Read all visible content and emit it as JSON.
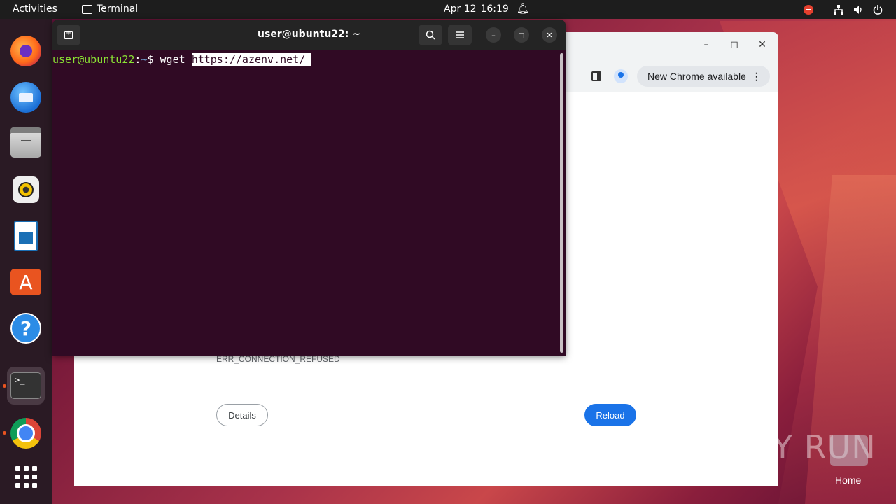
{
  "topbar": {
    "activities": "Activities",
    "app_name": "Terminal",
    "date": "Apr 12",
    "time": "16:19"
  },
  "dock": {
    "items": [
      "firefox-icon",
      "thunderbird-icon",
      "files-icon",
      "rhythmbox-icon",
      "libreoffice-writer-icon",
      "app-center-icon",
      "help-icon",
      "terminal-icon",
      "chrome-icon",
      "show-apps-icon"
    ],
    "store_glyph": "A",
    "help_glyph": "?",
    "terminal_glyph": ">_"
  },
  "terminal": {
    "title": "user@ubuntu22: ~",
    "prompt_user": "user@ubuntu22",
    "prompt_sep": ":",
    "prompt_path": "~",
    "prompt_symbol": "$ ",
    "command": "wget ",
    "selected_text": "https://azenv.net/ "
  },
  "chrome": {
    "new_chrome_label": "New Chrome available",
    "error_code": "ERR_CONNECTION_REFUSED",
    "details_label": "Details",
    "reload_label": "Reload"
  },
  "desktop": {
    "watermark": "ANY RUN",
    "home_label": "Home"
  },
  "colors": {
    "accent": "#e95420",
    "terminal_bg": "#300a24",
    "chrome_blue": "#1a73e8"
  }
}
